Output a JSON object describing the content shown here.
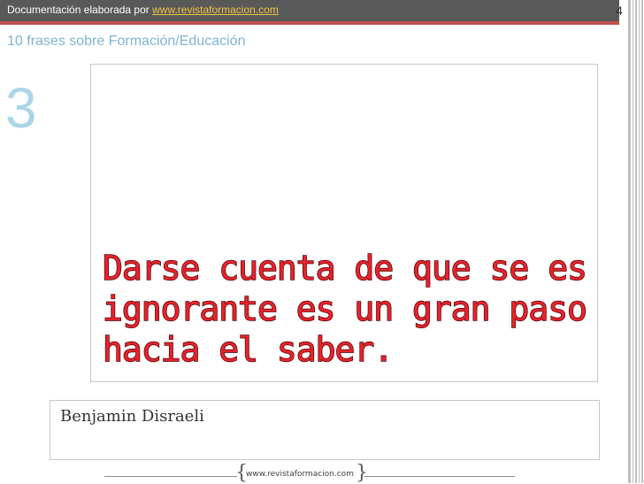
{
  "header": {
    "prefix": "Documentación elaborada por ",
    "link": "www.revistaformacion.com",
    "page_number": "4"
  },
  "slide": {
    "subtitle": "10 frases sobre Formación/Educación",
    "number": "3",
    "quote_lines": [
      "Darse cuenta de que se es",
      "ignorante es un gran paso",
      "hacia el saber."
    ],
    "author": "Benjamin Disraeli"
  },
  "footer": {
    "url": "www.revistaformacion.com"
  },
  "colors": {
    "accent_red": "#c0504d",
    "quote_red": "#e8222b",
    "subtitle_blue": "#7fb4d1",
    "number_blue": "#a9d6e8"
  }
}
